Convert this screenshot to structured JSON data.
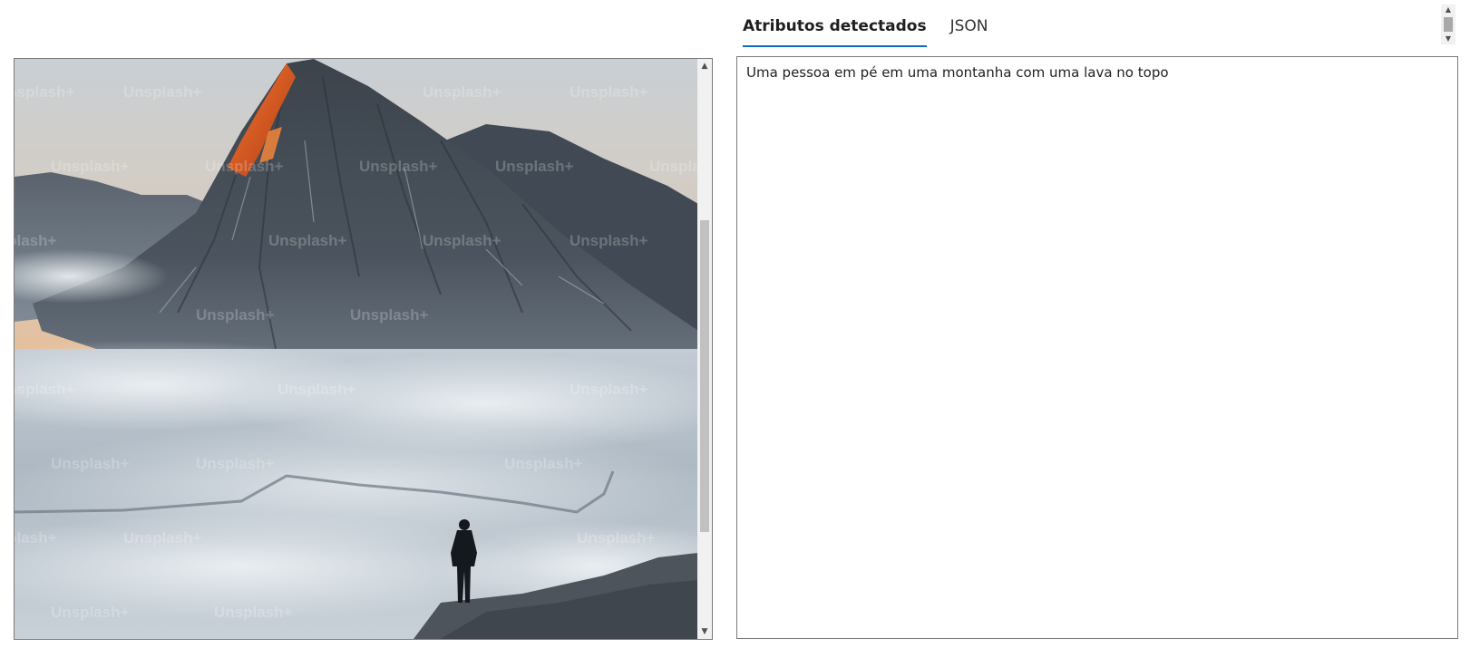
{
  "tabs": [
    {
      "label": "Atributos detectados",
      "active": true
    },
    {
      "label": "JSON",
      "active": false
    }
  ],
  "result": {
    "text": "Uma pessoa em pé em uma montanha com uma lava no topo"
  },
  "image": {
    "watermark": "Unsplash+",
    "subject_icon": "mountain-landscape-photo"
  },
  "icons": {
    "scroll_up": "▲",
    "scroll_down": "▼"
  },
  "colors": {
    "tab_underline": "#0f6cbd",
    "lava": "#e2531b",
    "sky_glow": "#f2b27a"
  }
}
